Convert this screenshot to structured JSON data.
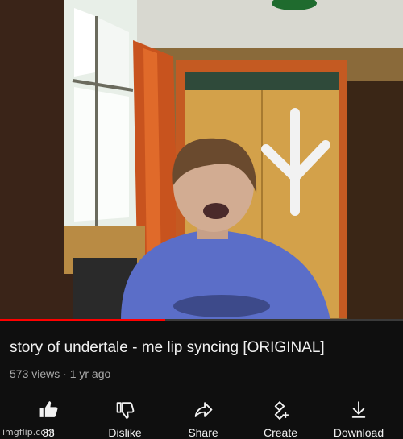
{
  "video": {
    "progress_fraction": 0.41
  },
  "info": {
    "title": "story of undertale - me lip syncing [ORIGINAL]",
    "meta": "573 views · 1 yr ago"
  },
  "actions": [
    {
      "label": "33",
      "icon": "like-icon"
    },
    {
      "label": "Dislike",
      "icon": "dislike-icon"
    },
    {
      "label": "Share",
      "icon": "share-icon"
    },
    {
      "label": "Create",
      "icon": "create-icon"
    },
    {
      "label": "Download",
      "icon": "download-icon"
    }
  ],
  "watermark": "imgflip.com",
  "colors": {
    "background": "#0f0f0f",
    "progress_played": "#ff0000",
    "text_primary": "#f1f1f1",
    "text_secondary": "#aaaaaa"
  }
}
